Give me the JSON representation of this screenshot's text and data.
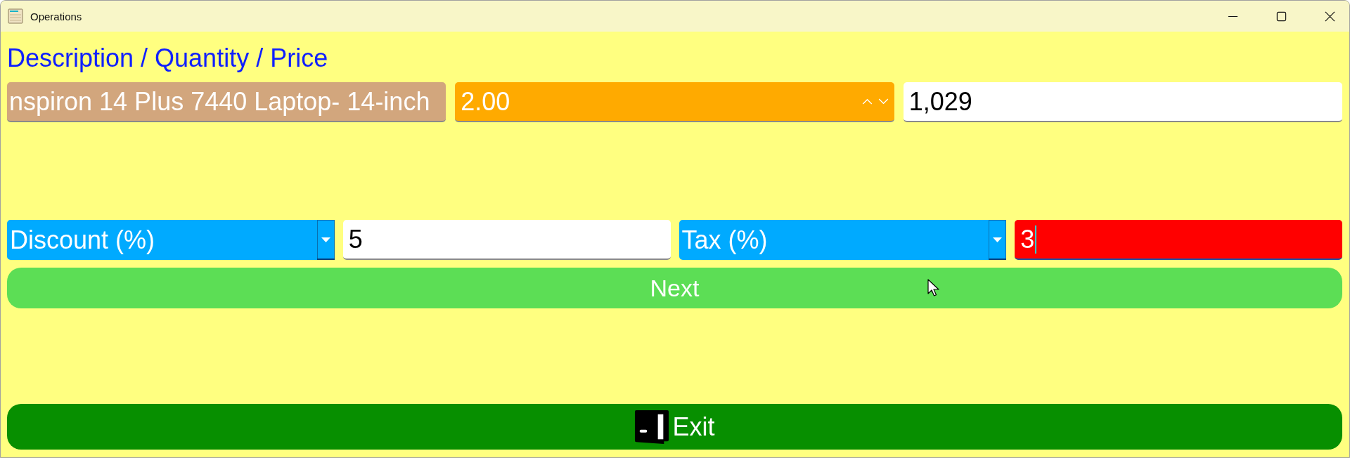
{
  "window": {
    "title": "Operations"
  },
  "heading": "Description / Quantity / Price",
  "item_fields": [
    {
      "kind": "text",
      "value": "nspiron 14 Plus 7440 Laptop- 14-inch",
      "focused": false
    },
    {
      "kind": "spinner",
      "value": "2.00",
      "focused": false
    },
    {
      "kind": "text",
      "value": "1,029",
      "focused": false
    }
  ],
  "adjustments": [
    {
      "label": "Discount (%)",
      "value": "5",
      "focused": false
    },
    {
      "label": "Tax (%)",
      "value": "3",
      "focused": true
    }
  ],
  "buttons": [
    {
      "kind": "next",
      "label": "Next"
    },
    {
      "kind": "exit",
      "label": "Exit"
    }
  ]
}
